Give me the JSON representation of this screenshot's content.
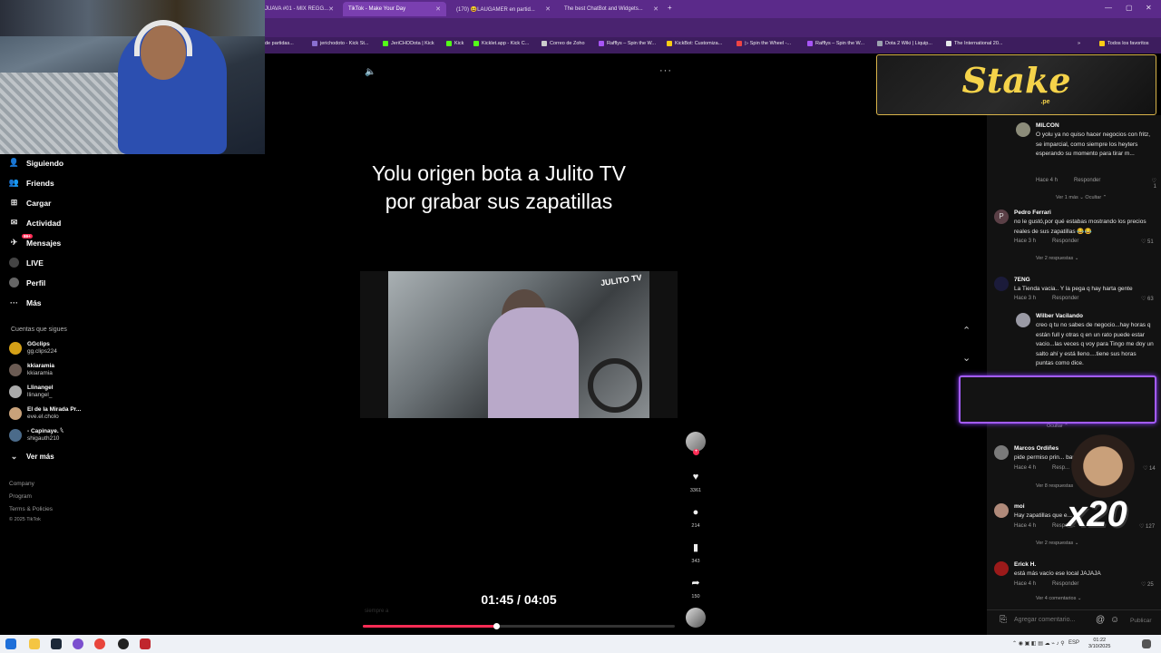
{
  "browser": {
    "tabs": [
      {
        "label": "JUAVA #01 - MIX REGG...",
        "active": false
      },
      {
        "label": "TikTok - Make Your Day",
        "active": true
      },
      {
        "label": "(170) 😆LAUGAMER en partid...",
        "active": false
      },
      {
        "label": "The best ChatBot and Widgets...",
        "active": false
      }
    ],
    "new_tab": "+",
    "bookmarks": [
      "de partidas...",
      "jerichodoto - Kick St...",
      "JeriCHODota | Kick",
      "Kick",
      "Kicklet.app - Kick C...",
      "Correo de Zoho",
      "Rafflys – Spin the W...",
      "KickBot: Customiza...",
      "▷ Spin the Wheel -...",
      "Rafflys – Spin the W...",
      "Dota 2 Wiki | Liquip...",
      "The International 20..."
    ],
    "all_favorites": "Todos los favoritos"
  },
  "sidebar": {
    "nav": [
      {
        "label": "Siguiendo",
        "icon": "following-icon"
      },
      {
        "label": "Friends",
        "icon": "friends-icon"
      },
      {
        "label": "Cargar",
        "icon": "upload-icon"
      },
      {
        "label": "Actividad",
        "icon": "activity-icon"
      },
      {
        "label": "Mensajes",
        "icon": "messages-icon",
        "badge": "99+"
      },
      {
        "label": "LIVE",
        "icon": "live-icon"
      },
      {
        "label": "Perfil",
        "icon": "profile-icon"
      },
      {
        "label": "Más",
        "icon": "more-icon"
      }
    ],
    "following_title": "Cuentas que sigues",
    "following": [
      {
        "name": "GGclips",
        "handle": "gg.clips224"
      },
      {
        "name": "kkiaramia",
        "handle": "kkiaramia"
      },
      {
        "name": "Llinangel",
        "handle": "llinangel_"
      },
      {
        "name": "El de la Mirada Pr...",
        "handle": "eve.el.cholo"
      },
      {
        "name": "- Capinaye. 𓆩",
        "handle": "shigauth210"
      }
    ],
    "see_more": "Ver más",
    "footer": [
      "Company",
      "Program",
      "Terms & Policies",
      "© 2025 TikTok"
    ]
  },
  "video": {
    "title": "Yolu origen bota a Julito TV por grabar sus zapatillas",
    "watermark": "JULITO TV",
    "time": "01:45 / 04:05",
    "progress_fraction": 0.428,
    "desc_ghost": "siempre a"
  },
  "actions": {
    "likes": "3361",
    "comments": "214",
    "saves": "343",
    "shares": "150"
  },
  "sponsor": {
    "brand": "Stake",
    "sub": ".pe"
  },
  "comments": [
    {
      "name": "MILCON",
      "text": "O yolu ya no quiso hacer negocios con fritz, se imparcial, como siempre los heyters esperando su momento para tirar m...",
      "time": "Hace 4 h",
      "reply": "Responder",
      "likes": "1",
      "more": "Ver 1 más ⌄     Ocultar ⌃"
    },
    {
      "name": "Pedro Ferrari",
      "text": "no le gustó,por qué estabas mostrando los precios reales de sus zapatillas 😂😂",
      "time": "Hace 3 h",
      "reply": "Responder",
      "likes": "51",
      "more": "Ver 2 respuestas ⌄"
    },
    {
      "name": "7ENG",
      "text": "La Tienda vacia.. Y la pega q hay harta gente",
      "time": "Hace 3 h",
      "reply": "Responder",
      "likes": "63",
      "more": ""
    },
    {
      "name": "Wilber Vacilando",
      "text": "creo q tu no sabes de negocio...hay horas q están full y otras q en un rato puede estar vacio...las veces q voy para Tingo me doy un salto ahí y está lleno....tiene sus horas puntas como dice.",
      "time": "",
      "reply": "",
      "likes": "",
      "more": "Ocultar ⌃"
    },
    {
      "name": "Marcos Ordiñes",
      "text": "pide permiso prin...                    bar",
      "time": "Hace 4 h",
      "reply": "Resp...",
      "likes": "14",
      "more": "Ver 8 respuestas"
    },
    {
      "name": "moi",
      "text": "Hay zapatillas que e...          no",
      "time": "Hace 4 h",
      "reply": "Respon...",
      "likes": "127",
      "more": "Ver 2 respuestas ⌄"
    },
    {
      "name": "Erick H.",
      "text": "está más vacío ese local JAJAJA",
      "time": "Hace 4 h",
      "reply": "Responder",
      "likes": "25",
      "more": "Ver 4 comentarios ⌄"
    }
  ],
  "overlay": {
    "multiplier": "x20"
  },
  "comment_input": {
    "placeholder": "Agregar comentario...",
    "publish": "Publicar"
  },
  "taskbar": {
    "time": "01:22",
    "date": "3/10/2025",
    "lang": "ESP"
  }
}
